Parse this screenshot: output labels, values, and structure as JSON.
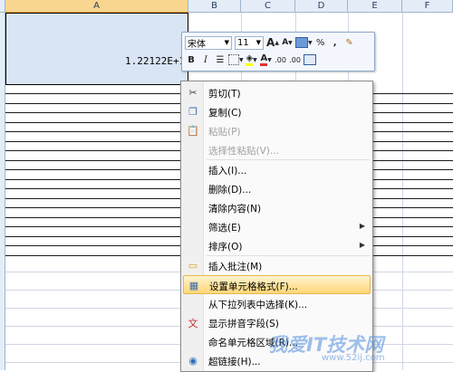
{
  "columns": [
    "A",
    "B",
    "C",
    "D",
    "E",
    "F"
  ],
  "cell_a1": {
    "value": "1.22122E+1"
  },
  "mini_toolbar": {
    "font_name": "宋体",
    "font_size": "11",
    "grow_font": "A",
    "shrink_font": "A",
    "percent": "%",
    "comma": ",",
    "bold": "B",
    "italic": "I",
    "font_color_letter": "A",
    "inc_decimal": ".00",
    "dec_decimal": ".00",
    "font_color": "#e03030",
    "fill_color": "#ffff00"
  },
  "context_menu": {
    "items": [
      {
        "label": "剪切(T)",
        "icon": "scissors-icon",
        "disabled": false
      },
      {
        "label": "复制(C)",
        "icon": "copy-icon",
        "disabled": false
      },
      {
        "label": "粘贴(P)",
        "icon": "paste-icon",
        "disabled": true
      },
      {
        "label": "选择性粘贴(V)...",
        "icon": "",
        "disabled": true
      },
      {
        "label": "插入(I)...",
        "icon": "",
        "disabled": false
      },
      {
        "label": "删除(D)...",
        "icon": "",
        "disabled": false
      },
      {
        "label": "清除内容(N)",
        "icon": "",
        "disabled": false
      },
      {
        "label": "筛选(E)",
        "icon": "",
        "disabled": false,
        "submenu": true
      },
      {
        "label": "排序(O)",
        "icon": "",
        "disabled": false,
        "submenu": true
      },
      {
        "label": "插入批注(M)",
        "icon": "comment-icon",
        "disabled": false
      },
      {
        "label": "设置单元格格式(F)...",
        "icon": "format-cells-icon",
        "disabled": false,
        "highlighted": true
      },
      {
        "label": "从下拉列表中选择(K)...",
        "icon": "",
        "disabled": false
      },
      {
        "label": "显示拼音字段(S)",
        "icon": "phonetic-icon",
        "disabled": false
      },
      {
        "label": "命名单元格区域(R)...",
        "icon": "",
        "disabled": false
      },
      {
        "label": "超链接(H)...",
        "icon": "hyperlink-icon",
        "disabled": false
      }
    ]
  },
  "watermark": {
    "text": "我爱IT技术网",
    "sub": "www.52ij.com"
  }
}
